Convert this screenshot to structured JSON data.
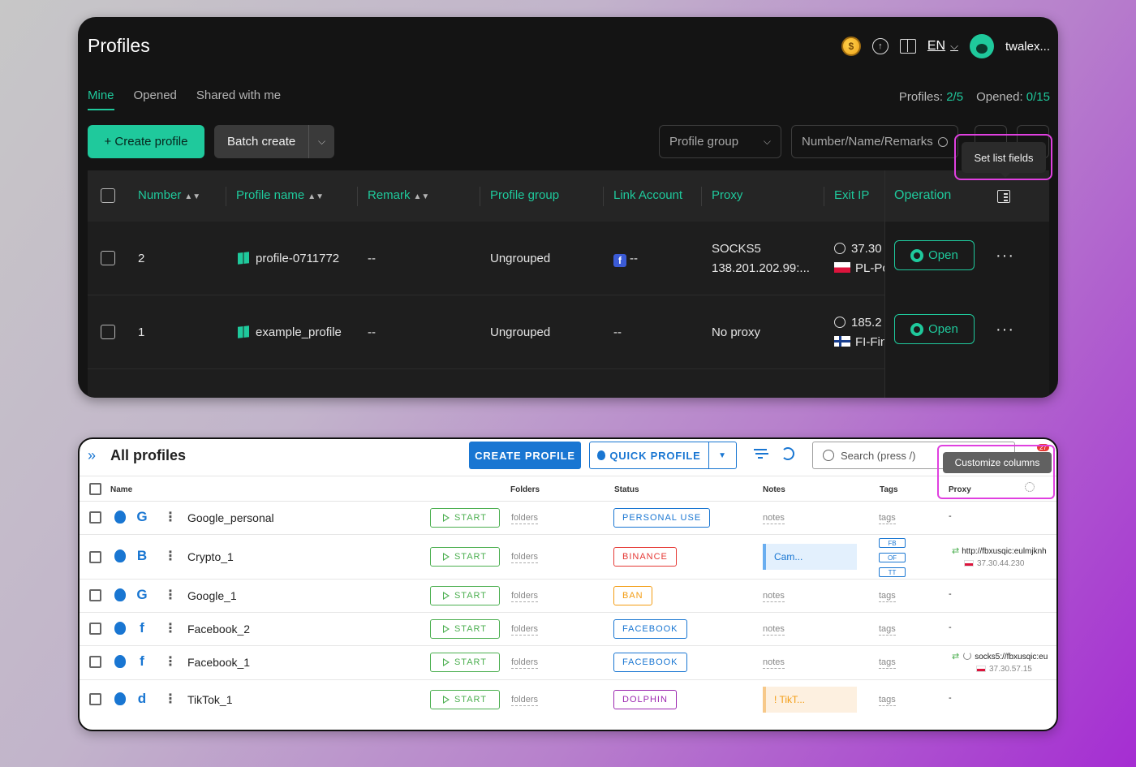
{
  "top": {
    "title": "Profiles",
    "header": {
      "lang": "EN",
      "user": "twalex..."
    },
    "tabs": [
      "Mine",
      "Opened",
      "Shared with me"
    ],
    "counts": {
      "profiles_label": "Profiles:",
      "profiles_value": "2/5",
      "opened_label": "Opened:",
      "opened_value": "0/15"
    },
    "toolbar": {
      "create": "+ Create profile",
      "batch": "Batch create",
      "group_placeholder": "Profile group",
      "search_placeholder": "Number/Name/Remarks"
    },
    "tooltip": "Set list fields",
    "columns": [
      "Number",
      "Profile name",
      "Remark",
      "Profile group",
      "Link Account",
      "Proxy",
      "Exit IP",
      "Operation"
    ],
    "rows": [
      {
        "number": "2",
        "name": "profile-0711772",
        "remark": "--",
        "group": "Ungrouped",
        "link": "--",
        "proxy_type": "SOCKS5",
        "proxy_addr": "138.201.202.99:...",
        "exit_ip": "37.30",
        "exit_loc": "PL-Po",
        "open": "Open"
      },
      {
        "number": "1",
        "name": "example_profile",
        "remark": "--",
        "group": "Ungrouped",
        "link": "--",
        "proxy_type": "No proxy",
        "proxy_addr": "",
        "exit_ip": "185.2",
        "exit_loc": "FI-Fin",
        "open": "Open"
      }
    ]
  },
  "bottom": {
    "title": "All profiles",
    "create_button": "CREATE PROFILE",
    "quick_button": "QUICK PROFILE",
    "search_placeholder": "Search (press /)",
    "badge": "27",
    "tooltip": "Customize columns",
    "columns": [
      "Name",
      "Folders",
      "Status",
      "Notes",
      "Tags",
      "Proxy"
    ],
    "start_label": "START",
    "folders_label": "folders",
    "notes_label": "notes",
    "tags_label": "tags",
    "rows": [
      {
        "name": "Google_personal",
        "service": "G",
        "status": "PERSONAL USE",
        "status_color": "#1976d2",
        "notes": "notes",
        "proxy": "-"
      },
      {
        "name": "Crypto_1",
        "service": "B",
        "status": "BINANCE",
        "status_color": "#e53935",
        "note_chip": "Cam...",
        "tags": [
          "FB",
          "OF",
          "TT"
        ],
        "proxy": "http://fbxusqic:eulmjknh",
        "proxy_ip": "37.30.44.230"
      },
      {
        "name": "Google_1",
        "service": "G",
        "status": "BAN",
        "status_color": "#f39c12",
        "notes": "notes",
        "proxy": "-"
      },
      {
        "name": "Facebook_2",
        "service": "f",
        "status": "FACEBOOK",
        "status_color": "#1976d2",
        "notes": "notes",
        "proxy": "-"
      },
      {
        "name": "Facebook_1",
        "service": "f",
        "status": "FACEBOOK",
        "status_color": "#1976d2",
        "notes": "notes",
        "proxy": "socks5://fbxusqic:eu",
        "proxy_ip": "37.30.57.15"
      },
      {
        "name": "TikTok_1",
        "service": "d",
        "status": "DOLPHIN",
        "status_color": "#9c27b0",
        "note_chip": "! TikT...",
        "proxy": "-"
      }
    ]
  }
}
